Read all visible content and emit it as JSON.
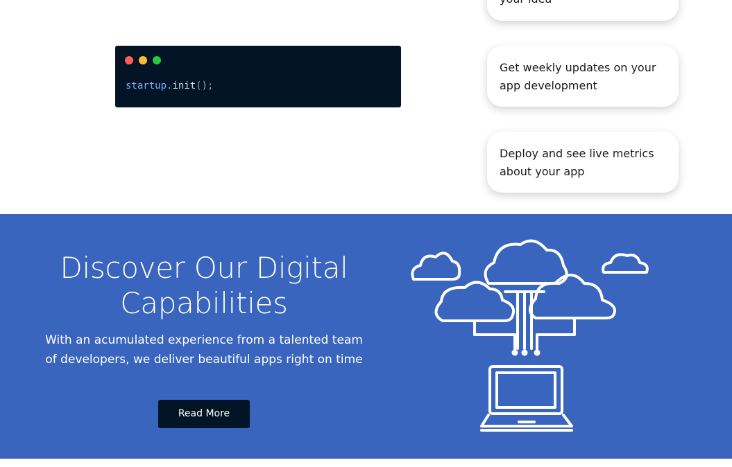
{
  "code_window": {
    "dot_colors": [
      "#ff5f57",
      "#febc2e",
      "#28c840"
    ],
    "code": {
      "object": "startup",
      "dot": ".",
      "method": "init",
      "rest": "();"
    }
  },
  "feature_cards": [
    {
      "text": "your idea"
    },
    {
      "text": "Get weekly updates on your app development"
    },
    {
      "text": "Deploy and see live metrics about your app"
    }
  ],
  "hero": {
    "title": "Discover Our Digital Capabilities",
    "description": "With an acumulated experience from a talented team of developers, we deliver beautiful apps right on time",
    "button_label": "Read More",
    "illustration_icon": "cloud-network-laptop-icon"
  },
  "colors": {
    "band_bg": "#3965be",
    "dark": "#021425",
    "white": "#ffffff"
  }
}
